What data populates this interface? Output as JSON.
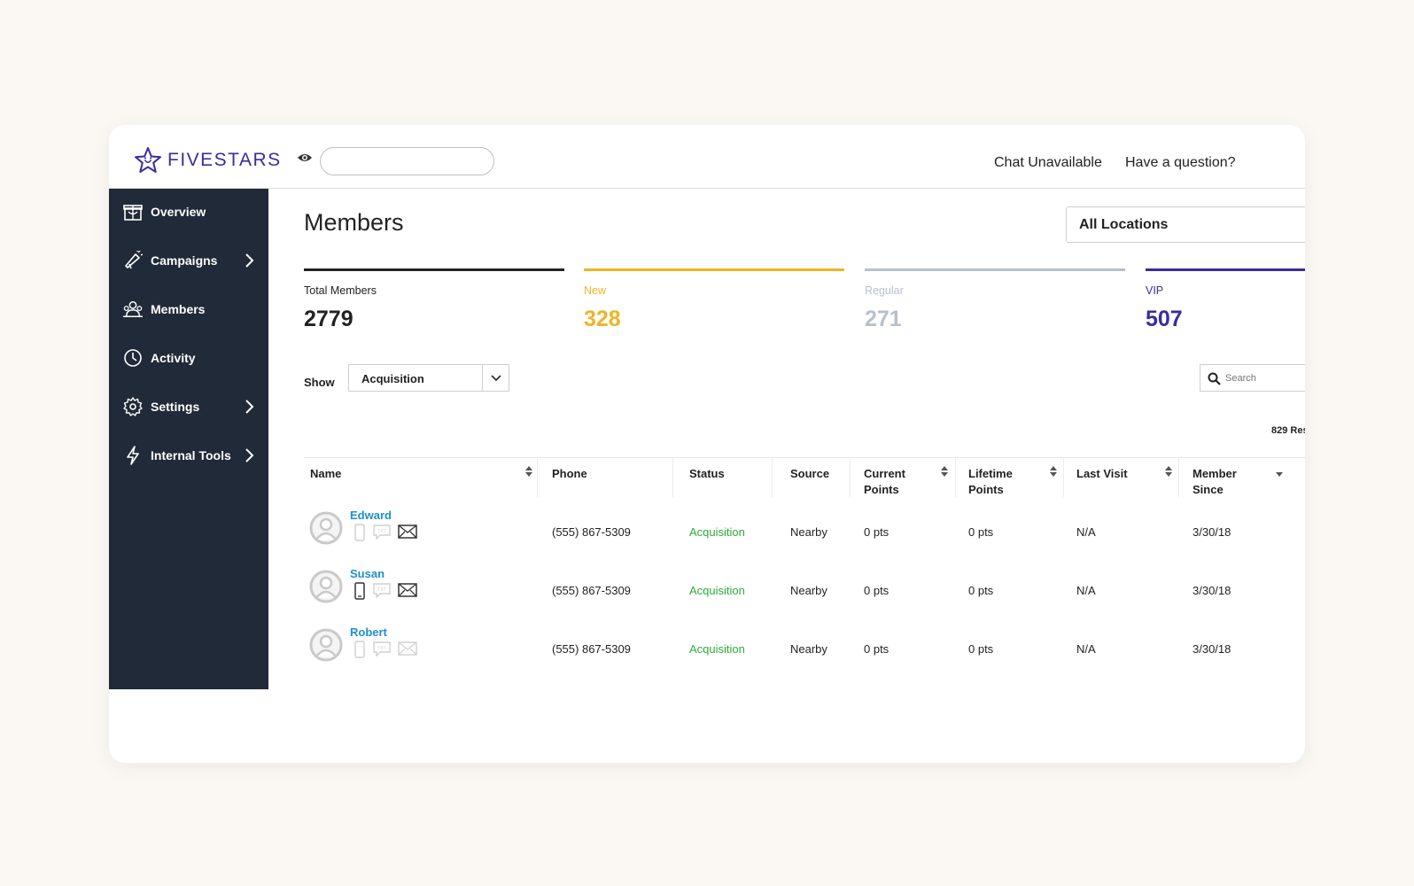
{
  "header": {
    "brand": "FIVESTARS",
    "search": {
      "value": "",
      "placeholder": ""
    },
    "chat_link": "Chat Unavailable",
    "question_link": "Have a question?"
  },
  "sidebar": {
    "items": [
      {
        "label": "Overview",
        "icon": "gift-icon",
        "has_chevron": false
      },
      {
        "label": "Campaigns",
        "icon": "megaphone-icon",
        "has_chevron": true
      },
      {
        "label": "Members",
        "icon": "people-icon",
        "has_chevron": false
      },
      {
        "label": "Activity",
        "icon": "clock-icon",
        "has_chevron": false
      },
      {
        "label": "Settings",
        "icon": "gear-icon",
        "has_chevron": true
      },
      {
        "label": "Internal Tools",
        "icon": "lightning-icon",
        "has_chevron": true
      }
    ]
  },
  "main": {
    "title": "Members",
    "location_select": "All Locations",
    "stats": [
      {
        "label": "Total Members",
        "value": "2779",
        "color": "#222222"
      },
      {
        "label": "New",
        "value": "328",
        "color": "#f0b323"
      },
      {
        "label": "Regular",
        "value": "271",
        "color": "#b8c0ca"
      },
      {
        "label": "VIP",
        "value": "507",
        "color": "#3a2da0"
      }
    ],
    "show_label": "Show",
    "show_select": "Acquisition",
    "search_placeholder": "Search",
    "results_count": "829 Res"
  },
  "table": {
    "columns": {
      "name": "Name",
      "phone": "Phone",
      "status": "Status",
      "source": "Source",
      "current_points_1": "Current",
      "current_points_2": "Points",
      "lifetime_points_1": "Lifetime",
      "lifetime_points_2": "Points",
      "last_visit": "Last Visit",
      "member_since_1": "Member",
      "member_since_2": "Since"
    },
    "rows": [
      {
        "name": "Edward",
        "phone": "(555) 867-5309",
        "status": "Acquisition",
        "source": "Nearby",
        "current_points": "0 pts",
        "lifetime_points": "0 pts",
        "last_visit": "N/A",
        "member_since": "3/30/18"
      },
      {
        "name": "Susan",
        "phone": "(555) 867-5309",
        "status": "Acquisition",
        "source": "Nearby",
        "current_points": "0 pts",
        "lifetime_points": "0 pts",
        "last_visit": "N/A",
        "member_since": "3/30/18"
      },
      {
        "name": "Robert",
        "phone": "(555) 867-5309",
        "status": "Acquisition",
        "source": "Nearby",
        "current_points": "0 pts",
        "lifetime_points": "0 pts",
        "last_visit": "N/A",
        "member_since": "3/30/18"
      }
    ]
  },
  "colors": {
    "brand": "#3a2da0",
    "sidebar_bg": "#212a38",
    "link": "#1e8fd0",
    "status_green": "#2eaa3c"
  }
}
